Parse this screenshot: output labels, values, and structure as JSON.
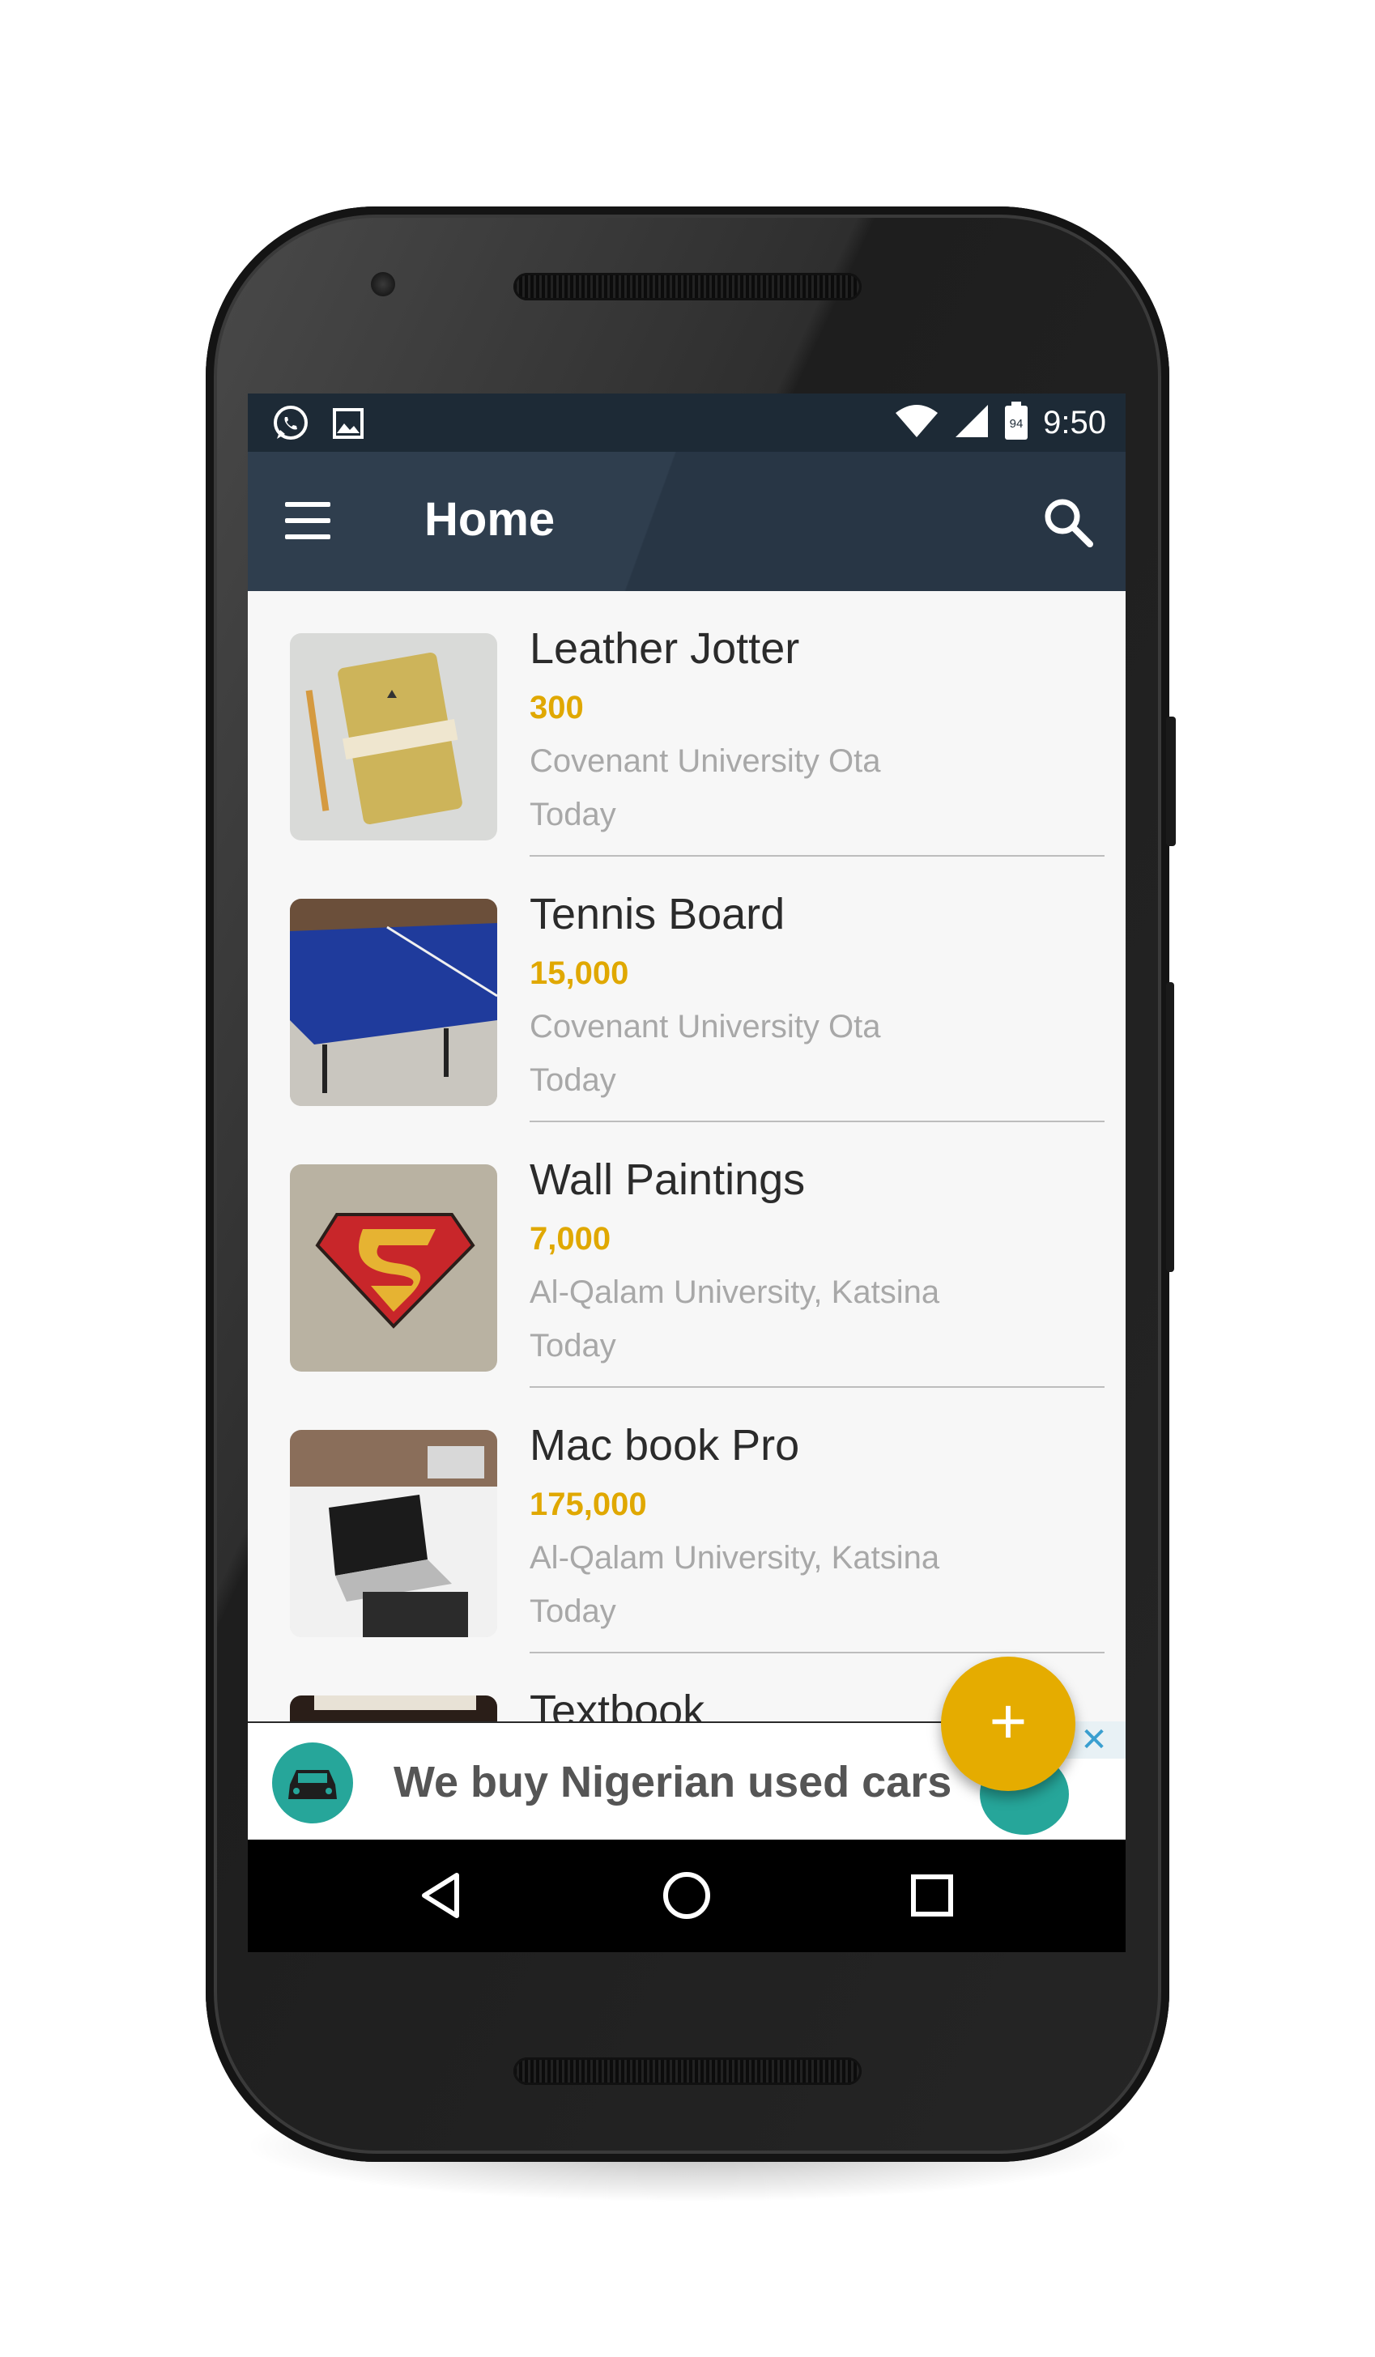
{
  "status_bar": {
    "time": "9:50",
    "battery_level": "94"
  },
  "app_bar": {
    "title": "Home"
  },
  "listings": [
    {
      "title": "Leather Jotter",
      "price": "300",
      "location": "Covenant University Ota",
      "date": "Today",
      "image": "notebook"
    },
    {
      "title": "Tennis Board",
      "price": "15,000",
      "location": "Covenant University Ota",
      "date": "Today",
      "image": "ping-pong-table"
    },
    {
      "title": "Wall Paintings",
      "price": "7,000",
      "location": "Al-Qalam University, Katsina",
      "date": "Today",
      "image": "superman-logo"
    },
    {
      "title": "Mac book Pro",
      "price": "175,000",
      "location": "Al-Qalam University, Katsina",
      "date": "Today",
      "image": "laptop-desk"
    },
    {
      "title": "Textbook",
      "image": "textbook"
    }
  ],
  "ad": {
    "text": "We buy Nigerian used cars"
  },
  "fab": {
    "label": "+"
  },
  "colors": {
    "app_bar": "#2f3e4e",
    "status_bar": "#1d2a36",
    "price": "#e0a800",
    "fab": "#e5ac00",
    "ad_accent": "#26a69a"
  }
}
